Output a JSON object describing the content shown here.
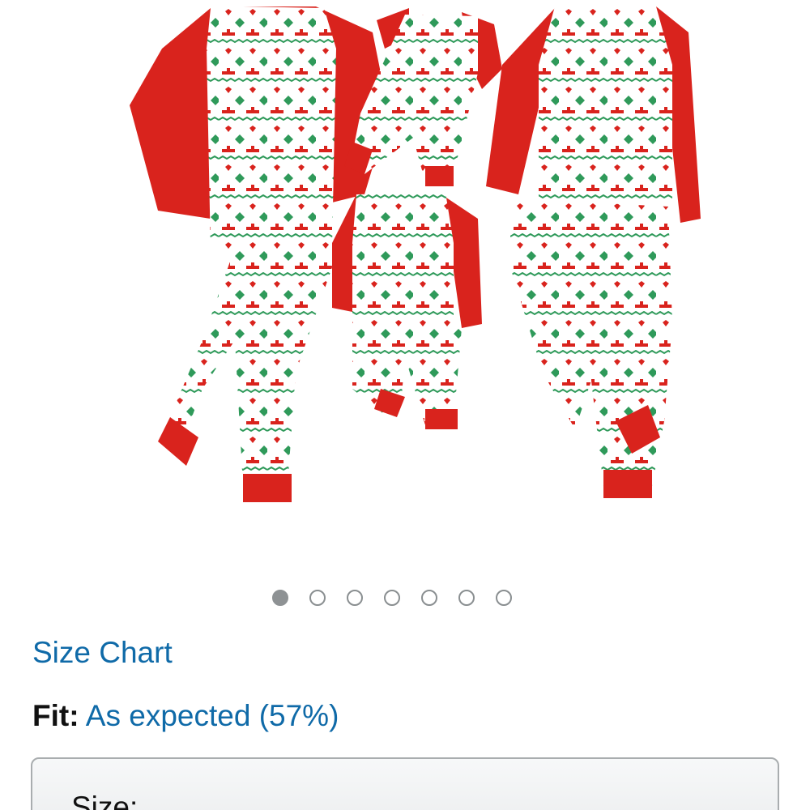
{
  "product": {
    "image_alt": "Matching family Christmas pajama set with red raglan sleeves and reindeer Fair Isle print"
  },
  "carousel": {
    "total_images": 7,
    "active_index": 0
  },
  "size_chart": {
    "label": "Size Chart"
  },
  "fit": {
    "label": "Fit:",
    "value": "As expected (57%)"
  },
  "size_selector": {
    "label": "Size:"
  },
  "colors": {
    "link": "#0f6aa8",
    "pajama_red": "#d9231d",
    "pattern_green": "#2f9a5a",
    "dot_border": "#8a8f91"
  }
}
